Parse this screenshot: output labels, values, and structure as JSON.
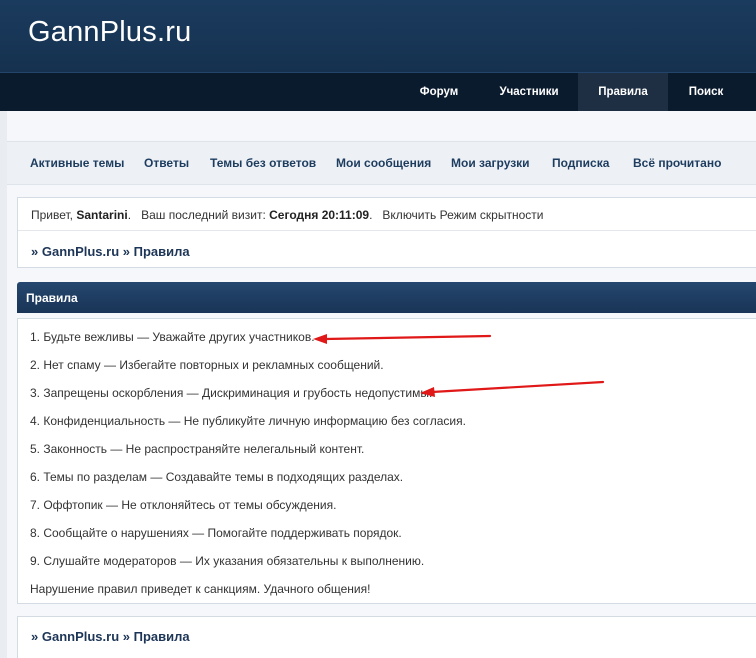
{
  "site": {
    "logo": "GannPlus.ru"
  },
  "navbar": {
    "items": [
      {
        "label": "Форум"
      },
      {
        "label": "Участники"
      },
      {
        "label": "Правила",
        "active": true
      },
      {
        "label": "Поиск"
      }
    ]
  },
  "subnav": {
    "items": [
      {
        "label": "Активные темы"
      },
      {
        "label": "Ответы"
      },
      {
        "label": "Темы без ответов"
      },
      {
        "label": "Мои сообщения"
      },
      {
        "label": "Мои загрузки"
      },
      {
        "label": "Подписка"
      },
      {
        "label": "Всё прочитано"
      }
    ]
  },
  "welcome": {
    "greeting": "Привет,",
    "username": "Santarini",
    "last_visit_label": "Ваш последний визит:",
    "last_visit_value": "Сегодня 20:11:09",
    "stealth_link": "Включить Режим скрытности"
  },
  "breadcrumb": {
    "sep": "»",
    "site": "GannPlus.ru",
    "page": "Правила"
  },
  "section": {
    "title": "Правила"
  },
  "rules": {
    "items": [
      "1. Будьте вежливы — Уважайте других участников.",
      "2. Нет спаму — Избегайте повторных и рекламных сообщений.",
      "3. Запрещены оскорбления — Дискриминация и грубость недопустимы.",
      "4. Конфиденциальность — Не публикуйте личную информацию без согласия.",
      "5. Законность — Не распространяйте нелегальный контент.",
      "6. Темы по разделам — Создавайте темы в подходящих разделах.",
      "7. Оффтопик — Не отклоняйтесь от темы обсуждения.",
      "8. Сообщайте о нарушениях — Помогайте поддерживать порядок.",
      "9. Слушайте модераторов — Их указания обязательны к выполнению."
    ],
    "footer": "Нарушение правил приведет к санкциям. Удачного общения!"
  },
  "annotations": {
    "arrow_color": "#e01818"
  },
  "colors": {
    "header_bg": "#1b3b5e",
    "navbar_bg": "#0b1b2e",
    "section_head_bg": "#25476f",
    "link_color": "#1d3c5e"
  }
}
